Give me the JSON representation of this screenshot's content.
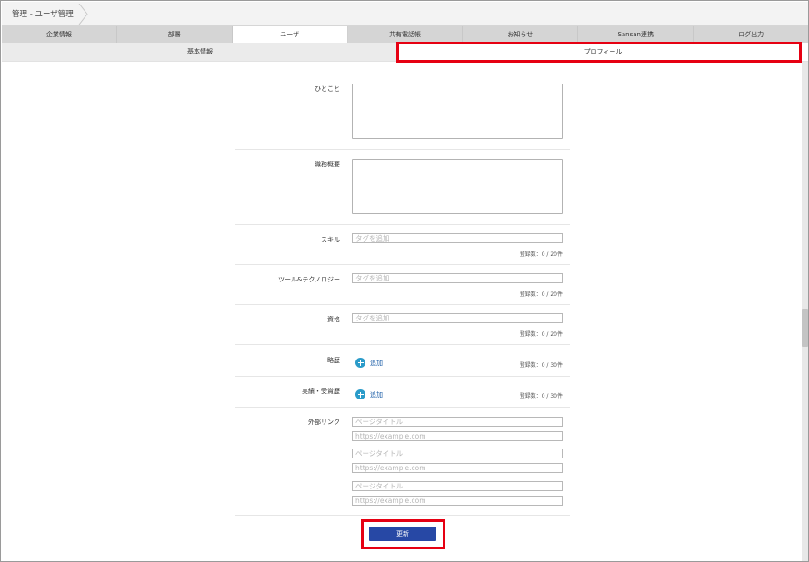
{
  "breadcrumb": {
    "text": "管理 - ユーザ管理"
  },
  "tabs": [
    {
      "label": "企業情報"
    },
    {
      "label": "部署"
    },
    {
      "label": "ユーザ"
    },
    {
      "label": "共有電話帳"
    },
    {
      "label": "お知らせ"
    },
    {
      "label": "Sansan連携"
    },
    {
      "label": "ログ出力"
    }
  ],
  "active_tab": "ユーザ",
  "subtabs": {
    "basic": "基本情報",
    "profile": "プロフィール"
  },
  "active_subtab": "プロフィール",
  "form": {
    "hitokoto": {
      "label": "ひとこと"
    },
    "career_summary": {
      "label": "職務概要"
    },
    "skill": {
      "label": "スキル",
      "placeholder": "タグを追加",
      "count": "登録数：0 / 20件"
    },
    "tools": {
      "label": "ツール&テクノロジー",
      "placeholder": "タグを追加",
      "count": "登録数：0 / 20件"
    },
    "qualification": {
      "label": "資格",
      "placeholder": "タグを追加",
      "count": "登録数：0 / 20件"
    },
    "history": {
      "label": "略歴",
      "add_label": "追加",
      "count": "登録数：0 / 30件"
    },
    "achievements": {
      "label": "実績・受賞歴",
      "add_label": "追加",
      "count": "登録数：0 / 30件"
    },
    "external_links": {
      "label": "外部リンク",
      "title_placeholder": "ページタイトル",
      "url_placeholder": "https://example.com"
    }
  },
  "update_button": {
    "label": "更新"
  },
  "colors": {
    "highlight": "#e60012",
    "primary_button": "#2748a5",
    "add_icon": "#2a9bc9"
  }
}
